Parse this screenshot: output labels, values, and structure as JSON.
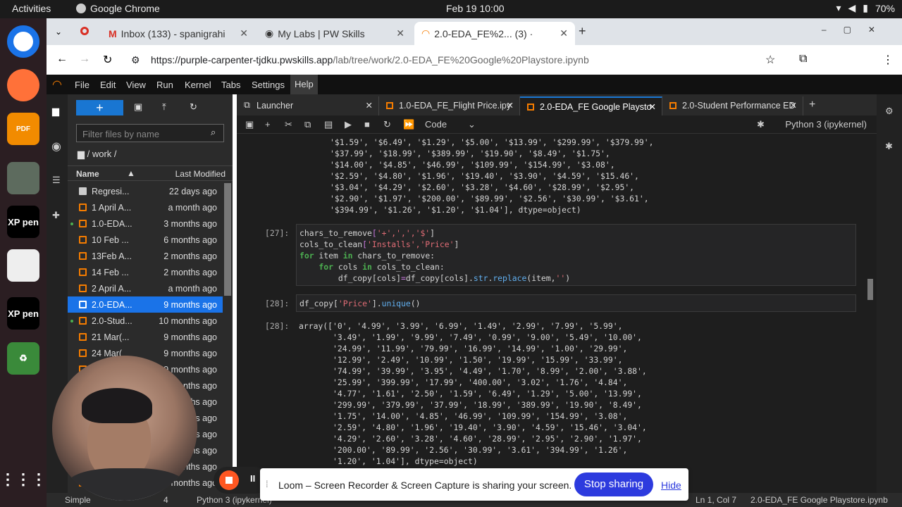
{
  "os": {
    "activities": "Activities",
    "app_name": "Google Chrome",
    "clock": "Feb 19  10:00",
    "battery": "70%"
  },
  "browser": {
    "tabs": [
      {
        "label": "Inbox (133) - spanigrahi",
        "active": false
      },
      {
        "label": "My Labs | PW Skills",
        "active": false
      },
      {
        "label": "2.0-EDA_FE%2...  (3) ·",
        "active": true
      }
    ],
    "url_main": "https://purple-carpenter-tjdku.pwskills.app",
    "url_rest": "/lab/tree/work/2.0-EDA_FE%20Google%20Playstore.ipynb"
  },
  "menu": [
    "File",
    "Edit",
    "View",
    "Run",
    "Kernel",
    "Tabs",
    "Settings",
    "Help"
  ],
  "filebrowser": {
    "filter_placeholder": "Filter files by name",
    "path": "/ work /",
    "col_name": "Name",
    "col_modified": "Last Modified",
    "files": [
      {
        "name": "Regresi...",
        "modified": "22 days ago",
        "type": "folder"
      },
      {
        "name": "1 April A...",
        "modified": "a month ago"
      },
      {
        "name": "1.0-EDA...",
        "modified": "3 months ago",
        "running": true
      },
      {
        "name": "10 Feb ...",
        "modified": "6 months ago"
      },
      {
        "name": "13Feb A...",
        "modified": "2 months ago"
      },
      {
        "name": "14 Feb ...",
        "modified": "2 months ago"
      },
      {
        "name": "2 April A...",
        "modified": "a month ago"
      },
      {
        "name": "2.0-EDA...",
        "modified": "9 months ago",
        "selected": true
      },
      {
        "name": "2.0-Stud...",
        "modified": "10 months ago",
        "running": true
      },
      {
        "name": "21 Mar(...",
        "modified": "9 months ago"
      },
      {
        "name": "24 Mar(",
        "modified": "9 months ago"
      },
      {
        "name": "",
        "modified": "9 months ago"
      },
      {
        "name": "",
        "modified": "months ago"
      },
      {
        "name": "",
        "modified": "months ago"
      },
      {
        "name": "",
        "modified": "months ago"
      },
      {
        "name": "",
        "modified": "months ago"
      },
      {
        "name": "",
        "modified": "months ago"
      },
      {
        "name": "",
        "modified": "months ago"
      },
      {
        "name": "",
        "modified": "months ago"
      }
    ]
  },
  "notebook_tabs": [
    {
      "label": "Launcher",
      "active": false
    },
    {
      "label": "1.0-EDA_FE_Flight Price.ipy",
      "active": false
    },
    {
      "label": "2.0-EDA_FE Google Playsto",
      "active": true
    },
    {
      "label": "2.0-Student Performance ED",
      "active": false
    }
  ],
  "toolbar": {
    "cell_type": "Code",
    "kernel": "Python 3 (ipykernel)"
  },
  "output_top": "       '$1.59', '$6.49', '$1.29', '$5.00', '$13.99', '$299.99', '$379.99',\n       '$37.99', '$18.99', '$389.99', '$19.90', '$8.49', '$1.75',\n       '$14.00', '$4.85', '$46.99', '$109.99', '$154.99', '$3.08',\n       '$2.59', '$4.80', '$1.96', '$19.40', '$3.90', '$4.59', '$15.46',\n       '$3.04', '$4.29', '$2.60', '$3.28', '$4.60', '$28.99', '$2.95',\n       '$2.90', '$1.97', '$200.00', '$89.99', '$2.56', '$30.99', '$3.61',\n       '$394.99', '$1.26', '$1.20', '$1.04'], dtype=object)",
  "cell27": {
    "prompt": "[27]:",
    "l1a": "chars_to_remove",
    "l1b": "[",
    "l1c": "'+',',','$'",
    "l1d": "]",
    "l2a": "cols_to_clean",
    "l2b": "[",
    "l2c": "'Installs','Price'",
    "l2d": "]",
    "l3a": "for",
    "l3b": " item ",
    "l3c": "in",
    "l3d": " chars_to_remove:",
    "l4a": "    for",
    "l4b": " cols ",
    "l4c": "in",
    "l4d": " cols_to_clean:",
    "l5": "        df_copy[cols]",
    "l5b": "=",
    "l5c": "df_copy[cols].",
    "l5d": "str",
    "l5e": ".",
    "l5f": "replace",
    "l5g": "(item,",
    "l5h": "''",
    "l5i": ")"
  },
  "cell28": {
    "prompt": "[28]:",
    "code_a": "df_copy[",
    "code_b": "'Price'",
    "code_c": "].",
    "code_d": "unique",
    "code_e": "()",
    "out_prompt": "[28]:"
  },
  "output28": "array(['0', '4.99', '3.99', '6.99', '1.49', '2.99', '7.99', '5.99',\n       '3.49', '1.99', '9.99', '7.49', '0.99', '9.00', '5.49', '10.00',\n       '24.99', '11.99', '79.99', '16.99', '14.99', '1.00', '29.99',\n       '12.99', '2.49', '10.99', '1.50', '19.99', '15.99', '33.99',\n       '74.99', '39.99', '3.95', '4.49', '1.70', '8.99', '2.00', '3.88',\n       '25.99', '399.99', '17.99', '400.00', '3.02', '1.76', '4.84',\n       '4.77', '1.61', '2.50', '1.59', '6.49', '1.29', '5.00', '13.99',\n       '299.99', '379.99', '37.99', '18.99', '389.99', '19.90', '8.49',\n       '1.75', '14.00', '4.85', '46.99', '109.99', '154.99', '3.08',\n       '2.59', '4.80', '1.96', '19.40', '3.90', '4.59', '15.46', '3.04',\n       '4.29', '2.60', '3.28', '4.60', '28.99', '2.95', '2.90', '1.97',\n       '200.00', '89.99', '2.56', '30.99', '3.61', '394.99', '1.26',\n       '1.20', '1.04'], dtype=object)",
  "statusbar": {
    "mode": "Simple",
    "count": "4",
    "kernel": "Python 3 (ipykernel)",
    "position": "Ln 1, Col 7",
    "file": "2.0-EDA_FE Google Playstore.ipynb"
  },
  "loom": {
    "message": "Loom – Screen Recorder & Screen Capture is sharing your screen.",
    "stop": "Stop sharing",
    "hide": "Hide"
  },
  "dock": [
    {
      "name": "chrome"
    },
    {
      "name": "firefox"
    },
    {
      "name": "pdf",
      "label": "PDF"
    },
    {
      "name": "files"
    },
    {
      "name": "xppen",
      "label": "XP pen"
    },
    {
      "name": "notes"
    },
    {
      "name": "xppen2",
      "label": "XP pen"
    },
    {
      "name": "trash"
    }
  ]
}
